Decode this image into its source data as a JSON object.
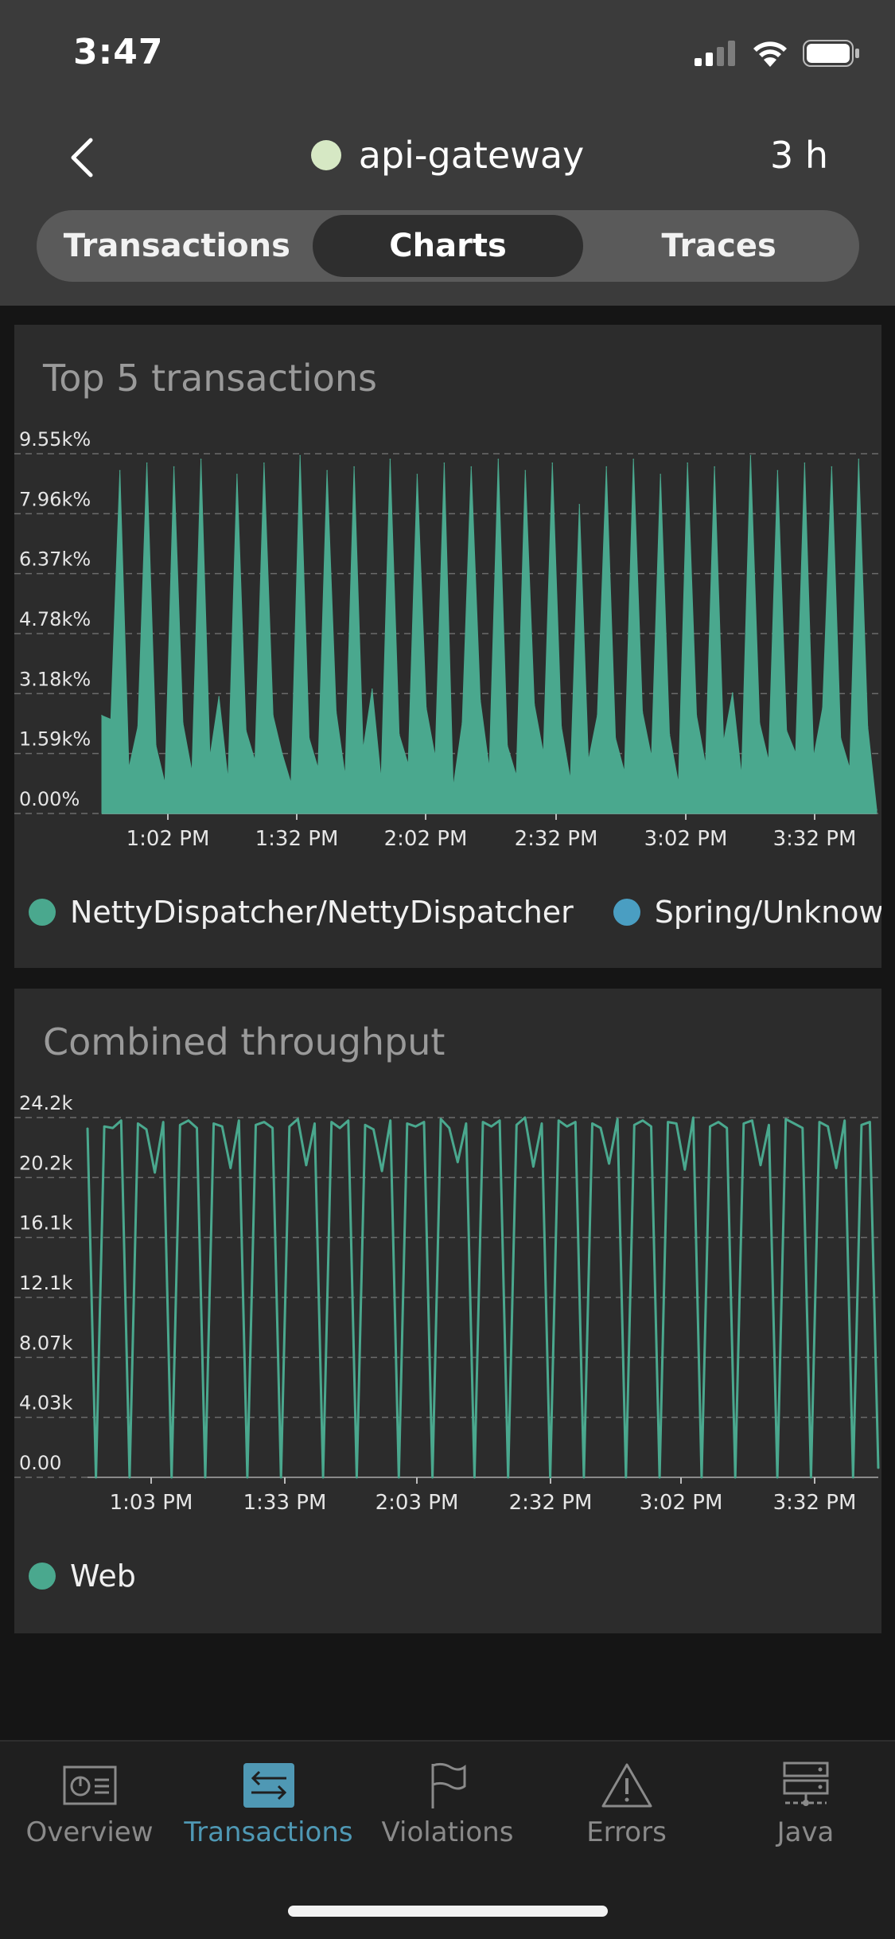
{
  "status_bar": {
    "time": "3:47"
  },
  "header": {
    "app_name": "api-gateway",
    "time_range": "3 h"
  },
  "segments": [
    {
      "label": "Transactions",
      "active": false
    },
    {
      "label": "Charts",
      "active": true
    },
    {
      "label": "Traces",
      "active": false
    }
  ],
  "colors": {
    "accent": "#4f98b4",
    "series_green": "#4aa88e",
    "series_blue": "#4a9ec2",
    "status_dot": "#d6e8c4"
  },
  "chart_data": [
    {
      "type": "area",
      "title": "Top 5 transactions",
      "ylim": [
        0,
        9550
      ],
      "y_ticks": [
        "0.00%",
        "1.59k%",
        "3.18k%",
        "4.78k%",
        "6.37k%",
        "7.96k%",
        "9.55k%"
      ],
      "x_ticks": [
        "1:02 PM",
        "1:32 PM",
        "2:02 PM",
        "2:32 PM",
        "3:02 PM",
        "3:32 PM"
      ],
      "grid": true,
      "legend": [
        "NettyDispatcher/NettyDispatcher",
        "Spring/Unknown Rout"
      ],
      "series": [
        {
          "name": "NettyDispatcher/NettyDispatcher",
          "values": [
            2600,
            2500,
            9100,
            1200,
            2300,
            9300,
            1800,
            800,
            9200,
            2400,
            1100,
            9400,
            1500,
            3100,
            900,
            9000,
            2200,
            1400,
            9300,
            2600,
            1600,
            800,
            9500,
            2000,
            1200,
            9100,
            2700,
            1000,
            9200,
            1700,
            3300,
            900,
            9400,
            2100,
            1300,
            9000,
            2800,
            1500,
            9300,
            700,
            2400,
            9200,
            3000,
            1200,
            9400,
            1800,
            1000,
            9100,
            2900,
            1600,
            9300,
            2300,
            900,
            8200,
            1400,
            2600,
            9200,
            2000,
            1100,
            9400,
            2700,
            1500,
            9000,
            2100,
            800,
            9300,
            2600,
            1300,
            9200,
            1900,
            3200,
            1000,
            9500,
            2400,
            1400,
            9100,
            2200,
            1600,
            9300,
            1500,
            2800,
            9200,
            2000,
            1200,
            9400,
            2300,
            100
          ]
        },
        {
          "name": "Spring/Unknown Rout",
          "values": []
        }
      ]
    },
    {
      "type": "line",
      "title": "Combined throughput",
      "ylim": [
        0,
        24200
      ],
      "y_ticks": [
        "0.00",
        "4.03k",
        "8.07k",
        "12.1k",
        "16.1k",
        "20.2k",
        "24.2k"
      ],
      "x_ticks": [
        "1:03 PM",
        "1:33 PM",
        "2:03 PM",
        "2:32 PM",
        "3:02 PM",
        "3:32 PM"
      ],
      "grid": true,
      "legend": [
        "Web"
      ],
      "series": [
        {
          "name": "Web",
          "values": [
            23500,
            0,
            23600,
            23500,
            24000,
            0,
            23800,
            23400,
            20500,
            23900,
            0,
            23700,
            24000,
            23500,
            0,
            23800,
            23600,
            20800,
            24000,
            0,
            23700,
            23900,
            23500,
            0,
            23600,
            24100,
            21000,
            23800,
            0,
            23900,
            23500,
            24000,
            0,
            23700,
            23400,
            20600,
            24000,
            0,
            23800,
            23600,
            23900,
            0,
            24100,
            23500,
            21200,
            23800,
            0,
            23900,
            23600,
            24000,
            0,
            23700,
            24200,
            20900,
            23800,
            0,
            24000,
            23600,
            23900,
            0,
            23800,
            23500,
            21100,
            24100,
            0,
            23700,
            24000,
            23600,
            0,
            23900,
            23800,
            20700,
            24200,
            0,
            23600,
            23900,
            23500,
            0,
            23800,
            24000,
            21000,
            23700,
            0,
            24100,
            23800,
            23500,
            0,
            23900,
            23600,
            20800,
            24000,
            0,
            23700,
            23900,
            600
          ]
        }
      ]
    }
  ],
  "tabbar": [
    {
      "label": "Overview",
      "icon": "overview-icon",
      "active": false
    },
    {
      "label": "Transactions",
      "icon": "transactions-icon",
      "active": true
    },
    {
      "label": "Violations",
      "icon": "flag-icon",
      "active": false
    },
    {
      "label": "Errors",
      "icon": "warning-icon",
      "active": false
    },
    {
      "label": "Java",
      "icon": "server-icon",
      "active": false
    }
  ]
}
